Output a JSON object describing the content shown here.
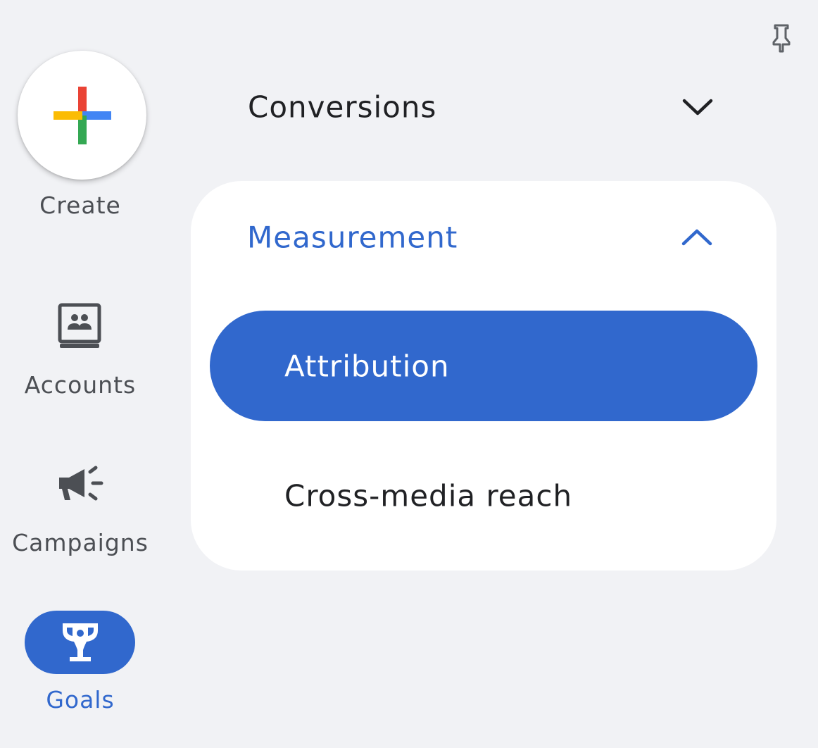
{
  "rail": {
    "create": {
      "label": "Create",
      "icon": "plus-icon"
    },
    "items": [
      {
        "label": "Accounts",
        "icon": "accounts-icon",
        "active": false
      },
      {
        "label": "Campaigns",
        "icon": "megaphone-icon",
        "active": false
      },
      {
        "label": "Goals",
        "icon": "trophy-icon",
        "active": true
      }
    ]
  },
  "pin": {
    "icon": "pin-icon"
  },
  "nav": {
    "conversions": {
      "label": "Conversions",
      "icon": "chevron-down-icon",
      "expanded": false
    },
    "measurement": {
      "label": "Measurement",
      "icon": "chevron-up-icon",
      "expanded": true,
      "items": [
        {
          "label": "Attribution",
          "selected": true
        },
        {
          "label": "Cross-media reach",
          "selected": false
        }
      ]
    }
  },
  "colors": {
    "accent": "#3168cd",
    "background": "#f1f2f5",
    "card": "#ffffff",
    "text_primary": "#202124",
    "text_secondary": "#4c4f54",
    "google_red": "#ea4335",
    "google_blue": "#4285f4",
    "google_green": "#34a853",
    "google_yellow": "#fbbc04"
  }
}
